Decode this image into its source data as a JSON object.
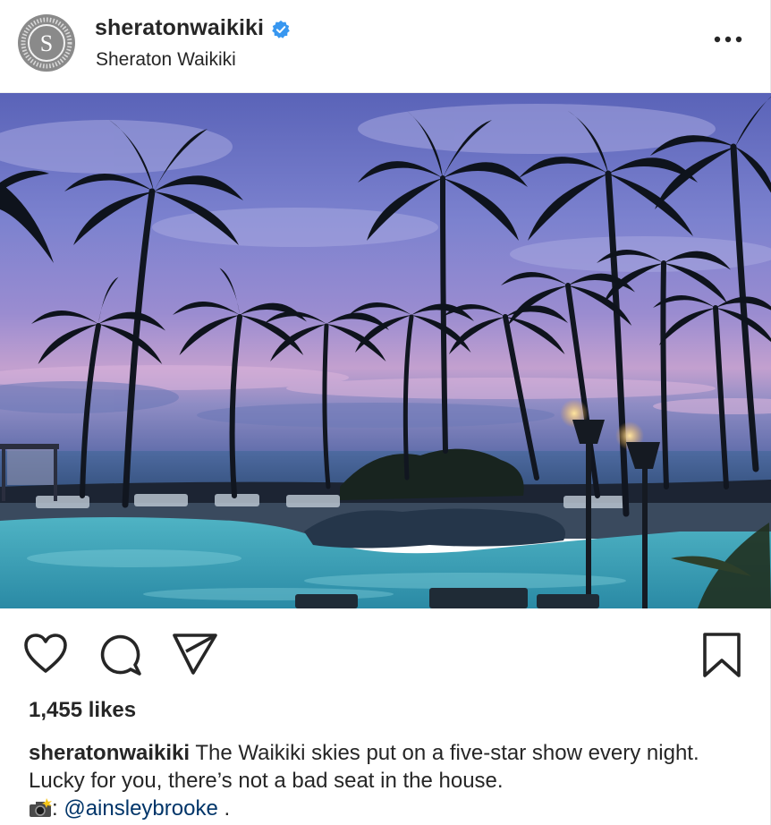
{
  "post": {
    "username": "sheratonwaikiki",
    "location": "Sheraton Waikiki",
    "verified": true,
    "likes": "1,455 likes",
    "caption": {
      "user": "sheratonwaikiki",
      "text": " The Waikiki skies put on a five-star show every night. Lucky for you, there’s not a bad seat in the house.",
      "credit_sep": ": ",
      "mention": "@ainsleybrooke",
      "end": " ."
    }
  },
  "icons": {
    "avatar": "sheraton-logo",
    "verified": "verified-badge-icon",
    "more": "more-options-icon",
    "like": "heart-icon",
    "comment": "comment-icon",
    "share": "paper-plane-icon",
    "save": "bookmark-icon",
    "camera": "camera-flash-emoji"
  },
  "colors": {
    "text": "#262626",
    "verified": "#3897f0",
    "mention": "#003569",
    "divider": "#efefef"
  }
}
